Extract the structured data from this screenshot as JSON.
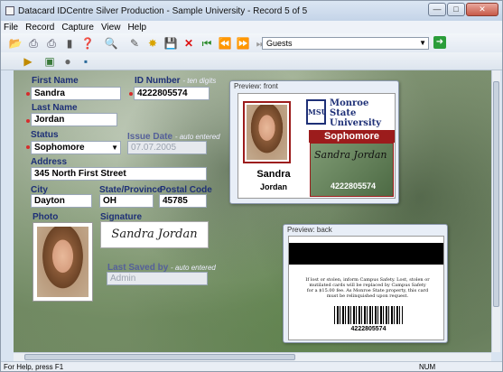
{
  "window": {
    "title": "Datacard IDCentre Silver Production - Sample University - Record 5 of 5"
  },
  "menu": [
    "File",
    "Record",
    "Capture",
    "View",
    "Help"
  ],
  "toolbar": {
    "dropdown_value": "Guests",
    "icons": [
      "open-folder-icon",
      "print-icon",
      "print-all-icon",
      "encode-icon",
      "help-icon",
      "find-icon",
      "edit-icon",
      "new-record-icon",
      "save-icon",
      "delete-icon",
      "first-record-icon",
      "previous-record-icon",
      "next-record-icon",
      "last-record-icon"
    ]
  },
  "form": {
    "first_name_label": "First Name",
    "first_name": "Sandra",
    "id_number_label": "ID Number",
    "id_number_sub": "- ten digits",
    "id_number": "4222805574",
    "last_name_label": "Last Name",
    "last_name": "Jordan",
    "status_label": "Status",
    "status": "Sophomore",
    "issue_date_label": "Issue Date",
    "issue_date_sub": "- auto entered",
    "issue_date": "07.07.2005",
    "address_label": "Address",
    "address": "345 North First Street",
    "city_label": "City",
    "city": "Dayton",
    "state_label": "State/Province",
    "state": "OH",
    "postal_label": "Postal Code",
    "postal": "45785",
    "photo_label": "Photo",
    "signature_label": "Signature",
    "signature_text": "Sandra Jordan",
    "last_saved_label": "Last Saved by",
    "last_saved_sub": "- auto entered",
    "last_saved": "Admin"
  },
  "preview_front": {
    "title": "Preview: front",
    "uni1": "Monroe",
    "uni2": "State",
    "uni3": "University",
    "level": "Sophomore",
    "first": "Sandra",
    "last": "Jordan",
    "sig": "Sandra Jordan",
    "id": "4222805574",
    "logo": "MSU"
  },
  "preview_back": {
    "title": "Preview: back",
    "text": "If lost or stolen, inform Campus Safety. Lost, stolen or mutilated cards will be replaced by Campus Safety for a $15.00 fee. As Monroe State property, this card must be relinquished upon request.",
    "id": "4222805574"
  },
  "status_bar": {
    "help": "For Help, press F1",
    "num": "NUM"
  },
  "colors": {
    "accent_red": "#9c1c1c",
    "label_blue": "#1e3077"
  }
}
